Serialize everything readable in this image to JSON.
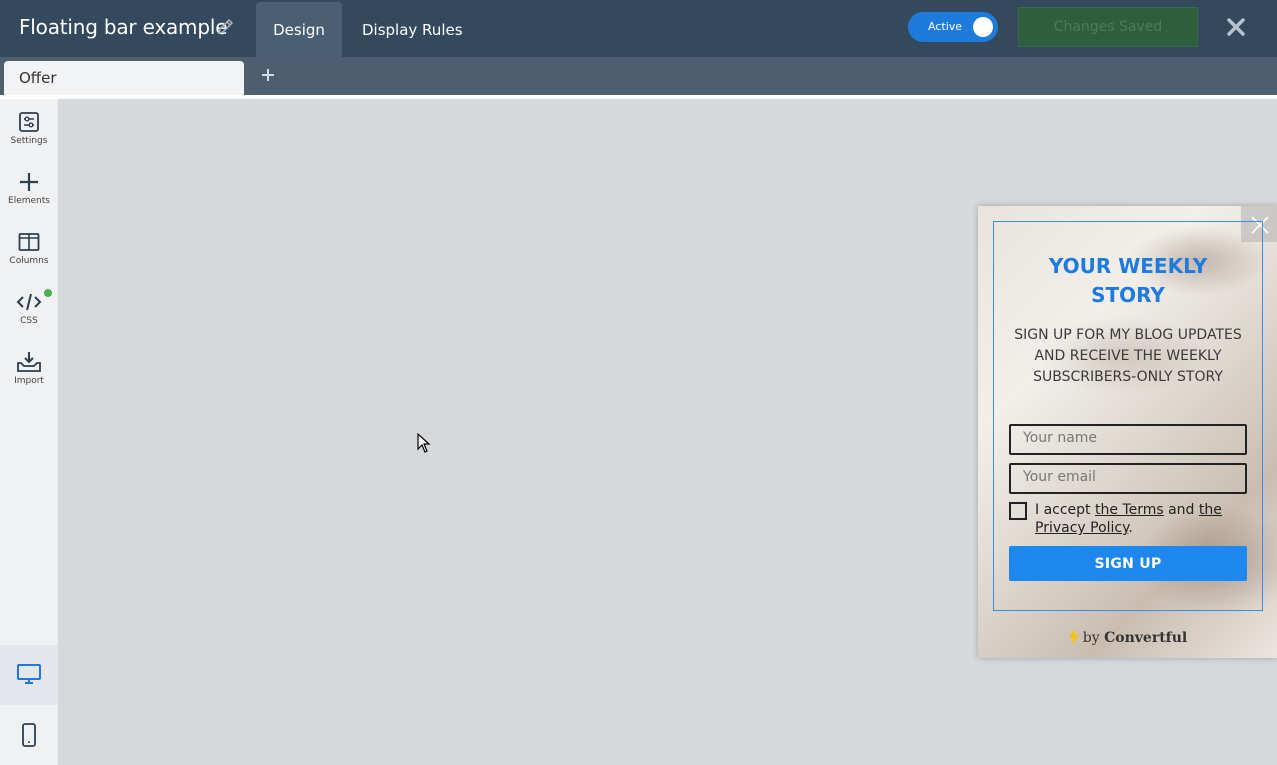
{
  "header": {
    "title": "Floating bar example",
    "tabs": [
      {
        "label": "Design",
        "active": true
      },
      {
        "label": "Display Rules",
        "active": false
      }
    ],
    "toggle_label": "Active",
    "saved_label": "Changes Saved"
  },
  "tabs_bar": {
    "current_tab": "Offer"
  },
  "sidebar": {
    "items": [
      {
        "label": "Settings",
        "icon": "settings-icon"
      },
      {
        "label": "Elements",
        "icon": "plus-icon"
      },
      {
        "label": "Columns",
        "icon": "columns-icon"
      },
      {
        "label": "CSS",
        "icon": "code-icon"
      },
      {
        "label": "Import",
        "icon": "import-icon"
      }
    ],
    "devices": [
      "desktop-icon",
      "mobile-icon"
    ]
  },
  "popup": {
    "heading_line1": "YOUR WEEKLY",
    "heading_line2": "STORY",
    "subheading": "SIGN UP FOR MY BLOG UPDATES AND RECEIVE THE WEEKLY SUBSCRIBERS-ONLY STORY",
    "name_placeholder": "Your name",
    "email_placeholder": "Your email",
    "terms_prefix": "I accept ",
    "terms_link": "the Terms",
    "terms_middle": " and ",
    "privacy_link1": "the",
    "privacy_link2": "Privacy Policy",
    "terms_suffix": ".",
    "button_label": "SIGN UP",
    "powered_by": "by",
    "brand": "Convertful"
  },
  "colors": {
    "header_bg": "#34495e",
    "accent": "#1e7bdc",
    "button": "#1e88f0",
    "saved_bg": "#2f5e3c"
  }
}
